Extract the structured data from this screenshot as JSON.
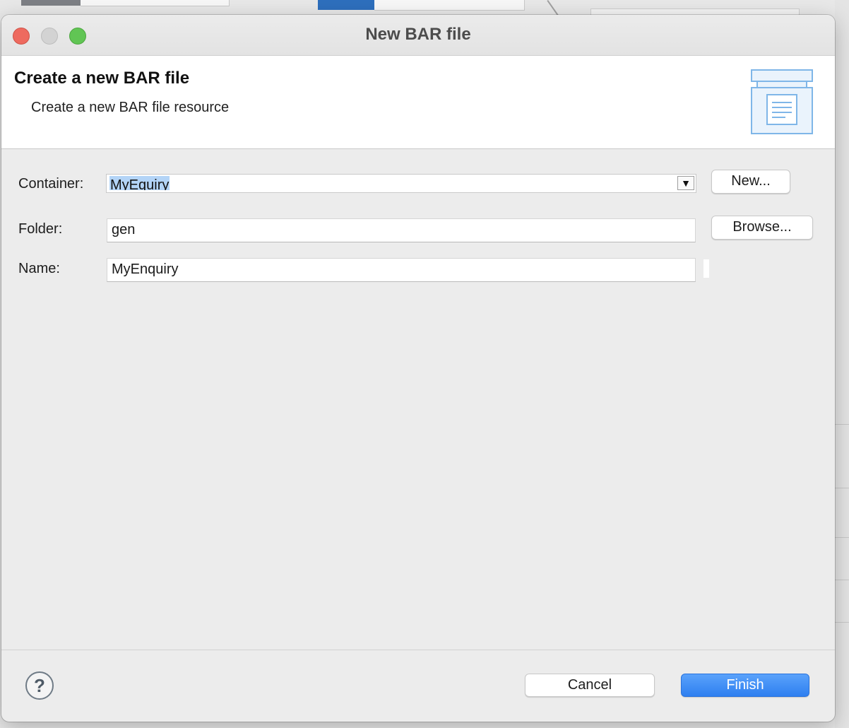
{
  "dialog": {
    "window_title": "New BAR file",
    "header_title": "Create a new BAR file",
    "header_subtitle": "Create a new BAR file resource"
  },
  "form": {
    "container_label": "Container:",
    "container_value": "MyEquiry",
    "new_button": "New...",
    "folder_label": "Folder:",
    "folder_value": "gen",
    "browse_button": "Browse...",
    "name_label": "Name:",
    "name_value": "MyEnquiry"
  },
  "footer": {
    "help_symbol": "?",
    "cancel_button": "Cancel",
    "finish_button": "Finish"
  },
  "icons": {
    "combo_arrow": "▼",
    "header_icon": "bar-file-wizard-icon"
  },
  "colors": {
    "primary_button": "#2e7ff0",
    "selection_highlight": "#b3d4f7",
    "close": "#ee6a5f",
    "minimize": "#d3d3d3",
    "maximize": "#61c554"
  }
}
